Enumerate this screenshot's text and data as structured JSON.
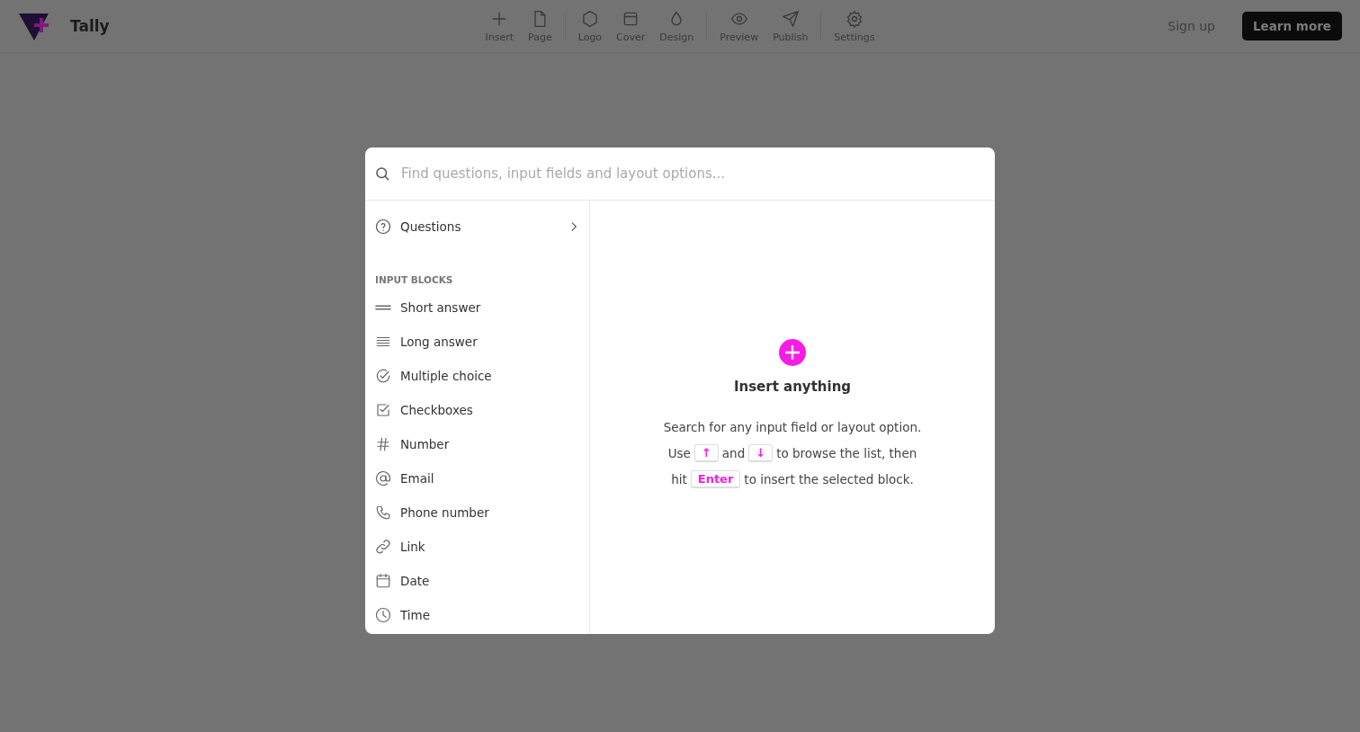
{
  "brand": {
    "name": "Tally"
  },
  "toolbar": [
    [
      "Insert",
      "Page"
    ],
    [
      "Logo",
      "Cover",
      "Design"
    ],
    [
      "Preview",
      "Publish"
    ],
    [
      "Settings"
    ]
  ],
  "actions": {
    "sign_up": "Sign up",
    "learn_more": "Learn more"
  },
  "search": {
    "placeholder": "Find questions, input fields and layout options..."
  },
  "menu": {
    "top_item": "Questions",
    "section": "INPUT BLOCKS",
    "items": [
      "Short answer",
      "Long answer",
      "Multiple choice",
      "Checkboxes",
      "Number",
      "Email",
      "Phone number",
      "Link",
      "Date",
      "Time"
    ]
  },
  "empty_state": {
    "title": "Insert anything",
    "lines": [
      [
        {
          "kind": "text",
          "text": "Search for any input field or layout option."
        }
      ],
      [
        {
          "kind": "text",
          "text": "Use"
        },
        {
          "kind": "key",
          "text": "↑"
        },
        {
          "kind": "text",
          "text": "and"
        },
        {
          "kind": "key",
          "text": "↓"
        },
        {
          "kind": "text",
          "text": "to browse the list, then"
        }
      ],
      [
        {
          "kind": "text",
          "text": "hit"
        },
        {
          "kind": "key",
          "text": "Enter"
        },
        {
          "kind": "text",
          "text": "to insert the selected block."
        }
      ]
    ]
  }
}
